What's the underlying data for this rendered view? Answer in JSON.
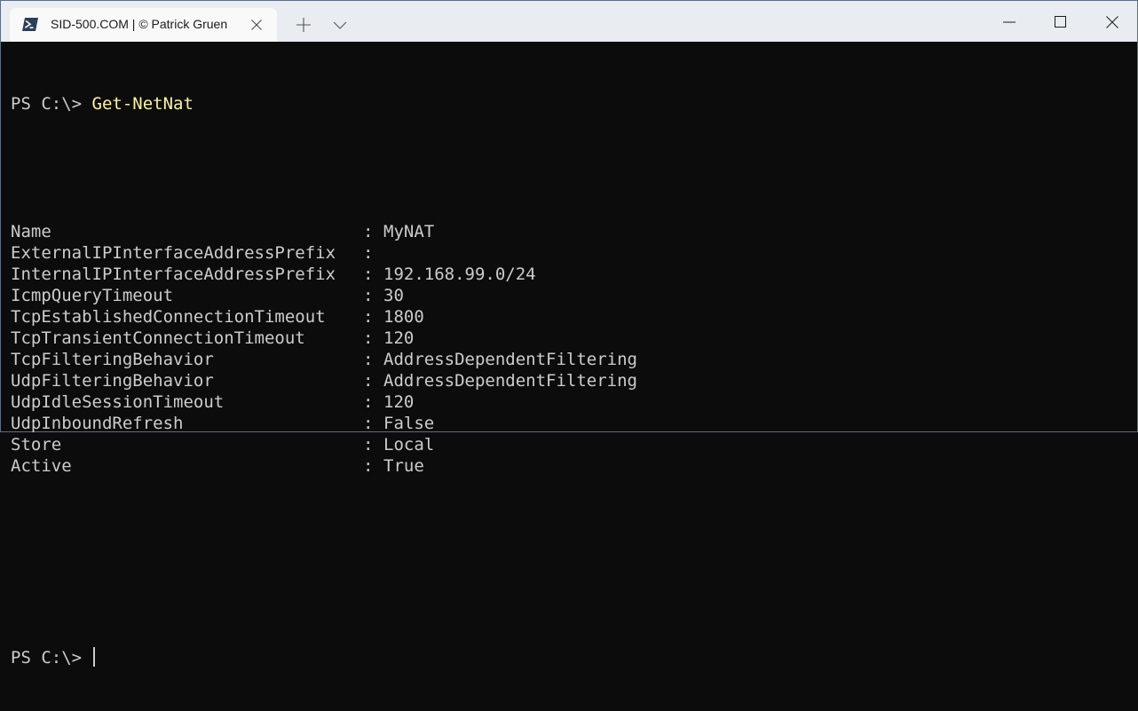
{
  "tab": {
    "title": "SID-500.COM | © Patrick Gruen",
    "icon": "powershell-icon"
  },
  "window_controls": {
    "minimize": "minimize-icon",
    "maximize": "maximize-icon",
    "close": "close-icon"
  },
  "console": {
    "prompt": "PS C:\\> ",
    "command": "Get-NetNat",
    "separator": ":",
    "properties": [
      {
        "name": "Name",
        "value": "MyNAT"
      },
      {
        "name": "ExternalIPInterfaceAddressPrefix",
        "value": ""
      },
      {
        "name": "InternalIPInterfaceAddressPrefix",
        "value": "192.168.99.0/24"
      },
      {
        "name": "IcmpQueryTimeout",
        "value": "30"
      },
      {
        "name": "TcpEstablishedConnectionTimeout",
        "value": "1800"
      },
      {
        "name": "TcpTransientConnectionTimeout",
        "value": "120"
      },
      {
        "name": "TcpFilteringBehavior",
        "value": "AddressDependentFiltering"
      },
      {
        "name": "UdpFilteringBehavior",
        "value": "AddressDependentFiltering"
      },
      {
        "name": "UdpIdleSessionTimeout",
        "value": "120"
      },
      {
        "name": "UdpInboundRefresh",
        "value": "False"
      },
      {
        "name": "Store",
        "value": "Local"
      },
      {
        "name": "Active",
        "value": "True"
      }
    ],
    "final_prompt": "PS C:\\> "
  },
  "colors": {
    "background": "#0c0c0c",
    "foreground": "#cccccc",
    "command": "#f9f1a5",
    "titlebar": "#e9ecf0",
    "tab": "#f9f9f9"
  }
}
